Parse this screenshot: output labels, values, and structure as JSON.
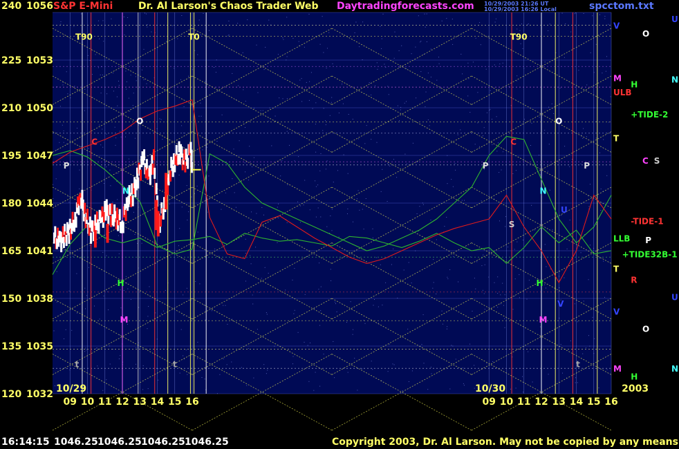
{
  "header": {
    "symbol": "S&P E-Mini",
    "title": "Dr. Al Larson's Chaos Trader Web",
    "site": "Daytradingforecasts.com",
    "stamp_line1": "10/29/2003 21:26 UT",
    "stamp_line2": "10/29/2003 16:26 Local",
    "file": "spcctom.txt",
    "first_axis_top": "240",
    "second_axis_top": "1056"
  },
  "footer": {
    "time": "16:14:15",
    "quotes": [
      "1046.25",
      "1046.25",
      "1046.25",
      "1046.25"
    ],
    "copyright": "Copyright 2003, Dr. Al Larson. May not be copied by any means."
  },
  "colors": {
    "background": "#000000",
    "plot_bg": "#000a55",
    "symbol": "#ff3333",
    "title": "#ffff66",
    "site": "#ff44ff",
    "axis_text": "#ffff66",
    "hour_text": "#ffff66",
    "green_line": "#2fb52f",
    "red_line": "#e01b1b",
    "price_up": "#ffffff",
    "price_down": "#ff1a1a",
    "grid": "#ffff55"
  },
  "chart_data": {
    "type": "line",
    "title": "S&P E-Mini",
    "xlabel": "",
    "ylabel": "",
    "y_left_ticks": [
      240,
      225,
      210,
      195,
      180,
      165,
      150,
      135,
      120
    ],
    "y_right_ticks": [
      1056,
      1053,
      1050,
      1047,
      1044,
      1041,
      1038,
      1035,
      1032
    ],
    "ylim": [
      1032,
      1056
    ],
    "date_labels": [
      "10/29",
      "10/30",
      "2003"
    ],
    "x_ticks": [
      "09",
      "10",
      "11",
      "12",
      "13",
      "14",
      "15",
      "16",
      "09",
      "10",
      "11",
      "12",
      "13",
      "14",
      "15",
      "16"
    ],
    "x_hours": [
      9,
      10,
      11,
      12,
      13,
      14,
      15,
      16,
      33,
      34,
      35,
      36,
      37,
      38,
      39,
      40
    ],
    "x_range_hours": [
      8,
      40
    ],
    "grid": true,
    "price_series": {
      "name": "",
      "x_hours": [
        8.1,
        8.4,
        8.7,
        9.0,
        9.3,
        9.6,
        9.9,
        10.2,
        10.5,
        10.8,
        11.1,
        11.4,
        11.7,
        12.0,
        12.3,
        12.6,
        12.9,
        13.2,
        13.5,
        13.8,
        14.1,
        14.4,
        14.7,
        15.0,
        15.3,
        15.6,
        15.9,
        16.0
      ],
      "values": [
        1041.8,
        1041.6,
        1041.9,
        1042.3,
        1043.0,
        1044.5,
        1043.2,
        1042.2,
        1042.6,
        1043.0,
        1043.5,
        1043.2,
        1043.1,
        1042.6,
        1044.2,
        1044.6,
        1045.6,
        1046.8,
        1045.6,
        1046.6,
        1042.6,
        1043.9,
        1045.9,
        1046.7,
        1047.2,
        1046.5,
        1047.3,
        1046.2
      ]
    },
    "down_bars": [
      {
        "x_hour": 10.45,
        "low": 1041.2,
        "high": 1042.3
      },
      {
        "x_hour": 11.15,
        "low": 1041.5,
        "high": 1042.7
      },
      {
        "x_hour": 13.95,
        "low": 1042.3,
        "high": 1044.2
      },
      {
        "x_hour": 14.05,
        "low": 1041.9,
        "high": 1043.5
      },
      {
        "x_hour": 14.5,
        "low": 1043.6,
        "high": 1045.9
      }
    ],
    "green_series": [
      {
        "x_hours": [
          8.0,
          9.0,
          10.0,
          11.0,
          12.0,
          13.0,
          14.0,
          15.0,
          16.0,
          17.0,
          18.0,
          19.0,
          20.0,
          21.0,
          22.0,
          23.0,
          24.0,
          25.0,
          26.0,
          27.0,
          28.0,
          29.0,
          30.0,
          31.0,
          32.0,
          33.0,
          34.0,
          35.0,
          36.0,
          37.0,
          38.0,
          39.0,
          40.0
        ],
        "values": [
          1047,
          1047.3,
          1046.9,
          1046.1,
          1045.1,
          1044.1,
          1041.3,
          1040.8,
          1041.1,
          1047.1,
          1046.5,
          1045,
          1044,
          1043.5,
          1043,
          1042.5,
          1042,
          1041.5,
          1041,
          1041.3,
          1041.8,
          1042.3,
          1043,
          1044,
          1045,
          1047,
          1048.2,
          1048,
          1045.5,
          1043,
          1041.5,
          1042.5,
          1044.5
        ]
      },
      {
        "x_hours": [
          8.0,
          9.0,
          10.0,
          11.0,
          12.0,
          13.0,
          14.0,
          15.0,
          16.0,
          17.0,
          18.0,
          19.0,
          20.0,
          21.0,
          22.0,
          23.0,
          24.0,
          25.0,
          26.0,
          27.0,
          28.0,
          29.0,
          30.0,
          31.0,
          32.0,
          33.0,
          34.0,
          35.0,
          36.0,
          37.0,
          38.0,
          39.0,
          40.0
        ],
        "values": [
          1039.5,
          1041.4,
          1042.6,
          1041.8,
          1041.5,
          1041.8,
          1041.2,
          1041.6,
          1041.7,
          1041.9,
          1041.4,
          1042.1,
          1041.8,
          1041.6,
          1041.7,
          1041.5,
          1041.3,
          1041.9,
          1041.8,
          1041.5,
          1041.2,
          1041.6,
          1042.1,
          1041.5,
          1041.0,
          1041.2,
          1040.2,
          1041.2,
          1042.5,
          1041.5,
          1042.3,
          1040.8,
          1041.0
        ]
      }
    ],
    "red_series": [
      {
        "x_hours": [
          8.0,
          9.0,
          10.0,
          11.0,
          12.0,
          13.0,
          14.0,
          15.0,
          16.0,
          17.0,
          18.0,
          19.0,
          20.0,
          21.0,
          22.0,
          23.0,
          24.0,
          25.0,
          26.0,
          27.0,
          28.0,
          29.0,
          30.0,
          31.0,
          32.0,
          33.0,
          34.0,
          35.0,
          36.0,
          37.0,
          38.0,
          39.0,
          40.0
        ],
        "values": [
          1046.5,
          1047.2,
          1047.6,
          1048.0,
          1048.5,
          1049.3,
          1049.8,
          1050.1,
          1050.5,
          1043.1,
          1040.8,
          1040.5,
          1042.8,
          1043.2,
          1042.5,
          1041.8,
          1041.2,
          1040.6,
          1040.2,
          1040.5,
          1041.0,
          1041.5,
          1042.0,
          1042.4,
          1042.7,
          1043,
          1044.5,
          1042.5,
          1041,
          1039,
          1041,
          1044.5,
          1043.0
        ]
      }
    ],
    "annotations": [
      {
        "text": "T90",
        "x_hour": 9.8,
        "y": 1054.5,
        "color": "#ffff66"
      },
      {
        "text": "T0",
        "x_hour": 16.1,
        "y": 1054.5,
        "color": "#ffff66"
      },
      {
        "text": "T90",
        "x_hour": 34.7,
        "y": 1054.5,
        "color": "#ffff66"
      },
      {
        "text": "O",
        "x_hour": 13.0,
        "y": 1049.2,
        "color": "#ffffff"
      },
      {
        "text": "O",
        "x_hour": 37.0,
        "y": 1049.2,
        "color": "#ffffff"
      },
      {
        "text": "C",
        "x_hour": 10.4,
        "y": 1047.9,
        "color": "#ff3333"
      },
      {
        "text": "C",
        "x_hour": 34.4,
        "y": 1047.9,
        "color": "#ff3333"
      },
      {
        "text": "P",
        "x_hour": 8.8,
        "y": 1046.4,
        "color": "#dddddd"
      },
      {
        "text": "P",
        "x_hour": 32.8,
        "y": 1046.4,
        "color": "#dddddd"
      },
      {
        "text": "P",
        "x_hour": 38.6,
        "y": 1046.4,
        "color": "#dddddd"
      },
      {
        "text": "N",
        "x_hour": 12.2,
        "y": 1044.8,
        "color": "#44ffff"
      },
      {
        "text": "N",
        "x_hour": 36.1,
        "y": 1044.8,
        "color": "#44ffff"
      },
      {
        "text": "S",
        "x_hour": 34.3,
        "y": 1042.7,
        "color": "#cccccc"
      },
      {
        "text": "H",
        "x_hour": 11.9,
        "y": 1039.0,
        "color": "#33ff33"
      },
      {
        "text": "H",
        "x_hour": 35.9,
        "y": 1039.0,
        "color": "#33ff33"
      },
      {
        "text": "M",
        "x_hour": 12.1,
        "y": 1036.7,
        "color": "#ff44ff"
      },
      {
        "text": "M",
        "x_hour": 36.1,
        "y": 1036.7,
        "color": "#ff44ff"
      },
      {
        "text": "U",
        "x_hour": 37.3,
        "y": 1043.6,
        "color": "#3344ff"
      },
      {
        "text": "V",
        "x_hour": 37.1,
        "y": 1037.7,
        "color": "#3344ff"
      },
      {
        "text": "t",
        "x_hour": 9.4,
        "y": 1033.9,
        "color": "#aaaaaa"
      },
      {
        "text": "t",
        "x_hour": 15.0,
        "y": 1033.9,
        "color": "#aaaaaa"
      },
      {
        "text": "t",
        "x_hour": 38.1,
        "y": 1033.9,
        "color": "#aaaaaa"
      }
    ],
    "right_labels": [
      {
        "text": "V",
        "y": 1055.2,
        "color": "#3344ff",
        "col": 0
      },
      {
        "text": "O",
        "y": 1054.7,
        "color": "#ffffff",
        "col": 1
      },
      {
        "text": "U",
        "y": 1055.6,
        "color": "#3344ff",
        "col": 2
      },
      {
        "text": "M",
        "y": 1051.9,
        "color": "#ff44ff",
        "col": 0
      },
      {
        "text": "N",
        "y": 1051.8,
        "color": "#44ffff",
        "col": 2
      },
      {
        "text": "H",
        "y": 1051.5,
        "color": "#33ff33",
        "col": 0.6
      },
      {
        "text": "ULB",
        "y": 1051.0,
        "color": "#ff3333",
        "col": 0
      },
      {
        "text": "+TIDE-2",
        "y": 1049.6,
        "color": "#33ff33",
        "col": 0.6
      },
      {
        "text": "T",
        "y": 1048.1,
        "color": "#ffff66",
        "col": 0
      },
      {
        "text": "C",
        "y": 1046.7,
        "color": "#ff44ff",
        "col": 1
      },
      {
        "text": "S",
        "y": 1046.7,
        "color": "#cccccc",
        "col": 1.4
      },
      {
        "text": "-TIDE-1",
        "y": 1042.9,
        "color": "#ff3333",
        "col": 0.6
      },
      {
        "text": "LLB",
        "y": 1041.8,
        "color": "#33ff33",
        "col": 0
      },
      {
        "text": "P",
        "y": 1041.7,
        "color": "#ffffff",
        "col": 1.1
      },
      {
        "text": "+TIDE32B-1",
        "y": 1040.8,
        "color": "#33ff33",
        "col": 0.3
      },
      {
        "text": "T",
        "y": 1039.9,
        "color": "#ffff66",
        "col": 0
      },
      {
        "text": "R",
        "y": 1039.2,
        "color": "#ff3333",
        "col": 0.6
      },
      {
        "text": "U",
        "y": 1038.1,
        "color": "#3344ff",
        "col": 2
      },
      {
        "text": "V",
        "y": 1037.2,
        "color": "#3344ff",
        "col": 0
      },
      {
        "text": "O",
        "y": 1036.1,
        "color": "#ffffff",
        "col": 1
      },
      {
        "text": "M",
        "y": 1033.6,
        "color": "#ff44ff",
        "col": 0
      },
      {
        "text": "N",
        "y": 1033.6,
        "color": "#44ffff",
        "col": 2
      },
      {
        "text": "H",
        "y": 1033.1,
        "color": "#33ff33",
        "col": 0.6
      }
    ]
  }
}
